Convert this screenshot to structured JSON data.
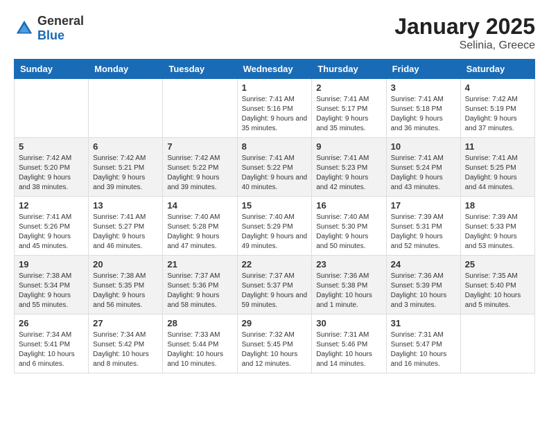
{
  "logo": {
    "general": "General",
    "blue": "Blue"
  },
  "title": "January 2025",
  "subtitle": "Selinia, Greece",
  "weekdays": [
    "Sunday",
    "Monday",
    "Tuesday",
    "Wednesday",
    "Thursday",
    "Friday",
    "Saturday"
  ],
  "weeks": [
    [
      {
        "day": "",
        "info": ""
      },
      {
        "day": "",
        "info": ""
      },
      {
        "day": "",
        "info": ""
      },
      {
        "day": "1",
        "info": "Sunrise: 7:41 AM\nSunset: 5:16 PM\nDaylight: 9 hours and 35 minutes."
      },
      {
        "day": "2",
        "info": "Sunrise: 7:41 AM\nSunset: 5:17 PM\nDaylight: 9 hours and 35 minutes."
      },
      {
        "day": "3",
        "info": "Sunrise: 7:41 AM\nSunset: 5:18 PM\nDaylight: 9 hours and 36 minutes."
      },
      {
        "day": "4",
        "info": "Sunrise: 7:42 AM\nSunset: 5:19 PM\nDaylight: 9 hours and 37 minutes."
      }
    ],
    [
      {
        "day": "5",
        "info": "Sunrise: 7:42 AM\nSunset: 5:20 PM\nDaylight: 9 hours and 38 minutes."
      },
      {
        "day": "6",
        "info": "Sunrise: 7:42 AM\nSunset: 5:21 PM\nDaylight: 9 hours and 39 minutes."
      },
      {
        "day": "7",
        "info": "Sunrise: 7:42 AM\nSunset: 5:22 PM\nDaylight: 9 hours and 39 minutes."
      },
      {
        "day": "8",
        "info": "Sunrise: 7:41 AM\nSunset: 5:22 PM\nDaylight: 9 hours and 40 minutes."
      },
      {
        "day": "9",
        "info": "Sunrise: 7:41 AM\nSunset: 5:23 PM\nDaylight: 9 hours and 42 minutes."
      },
      {
        "day": "10",
        "info": "Sunrise: 7:41 AM\nSunset: 5:24 PM\nDaylight: 9 hours and 43 minutes."
      },
      {
        "day": "11",
        "info": "Sunrise: 7:41 AM\nSunset: 5:25 PM\nDaylight: 9 hours and 44 minutes."
      }
    ],
    [
      {
        "day": "12",
        "info": "Sunrise: 7:41 AM\nSunset: 5:26 PM\nDaylight: 9 hours and 45 minutes."
      },
      {
        "day": "13",
        "info": "Sunrise: 7:41 AM\nSunset: 5:27 PM\nDaylight: 9 hours and 46 minutes."
      },
      {
        "day": "14",
        "info": "Sunrise: 7:40 AM\nSunset: 5:28 PM\nDaylight: 9 hours and 47 minutes."
      },
      {
        "day": "15",
        "info": "Sunrise: 7:40 AM\nSunset: 5:29 PM\nDaylight: 9 hours and 49 minutes."
      },
      {
        "day": "16",
        "info": "Sunrise: 7:40 AM\nSunset: 5:30 PM\nDaylight: 9 hours and 50 minutes."
      },
      {
        "day": "17",
        "info": "Sunrise: 7:39 AM\nSunset: 5:31 PM\nDaylight: 9 hours and 52 minutes."
      },
      {
        "day": "18",
        "info": "Sunrise: 7:39 AM\nSunset: 5:33 PM\nDaylight: 9 hours and 53 minutes."
      }
    ],
    [
      {
        "day": "19",
        "info": "Sunrise: 7:38 AM\nSunset: 5:34 PM\nDaylight: 9 hours and 55 minutes."
      },
      {
        "day": "20",
        "info": "Sunrise: 7:38 AM\nSunset: 5:35 PM\nDaylight: 9 hours and 56 minutes."
      },
      {
        "day": "21",
        "info": "Sunrise: 7:37 AM\nSunset: 5:36 PM\nDaylight: 9 hours and 58 minutes."
      },
      {
        "day": "22",
        "info": "Sunrise: 7:37 AM\nSunset: 5:37 PM\nDaylight: 9 hours and 59 minutes."
      },
      {
        "day": "23",
        "info": "Sunrise: 7:36 AM\nSunset: 5:38 PM\nDaylight: 10 hours and 1 minute."
      },
      {
        "day": "24",
        "info": "Sunrise: 7:36 AM\nSunset: 5:39 PM\nDaylight: 10 hours and 3 minutes."
      },
      {
        "day": "25",
        "info": "Sunrise: 7:35 AM\nSunset: 5:40 PM\nDaylight: 10 hours and 5 minutes."
      }
    ],
    [
      {
        "day": "26",
        "info": "Sunrise: 7:34 AM\nSunset: 5:41 PM\nDaylight: 10 hours and 6 minutes."
      },
      {
        "day": "27",
        "info": "Sunrise: 7:34 AM\nSunset: 5:42 PM\nDaylight: 10 hours and 8 minutes."
      },
      {
        "day": "28",
        "info": "Sunrise: 7:33 AM\nSunset: 5:44 PM\nDaylight: 10 hours and 10 minutes."
      },
      {
        "day": "29",
        "info": "Sunrise: 7:32 AM\nSunset: 5:45 PM\nDaylight: 10 hours and 12 minutes."
      },
      {
        "day": "30",
        "info": "Sunrise: 7:31 AM\nSunset: 5:46 PM\nDaylight: 10 hours and 14 minutes."
      },
      {
        "day": "31",
        "info": "Sunrise: 7:31 AM\nSunset: 5:47 PM\nDaylight: 10 hours and 16 minutes."
      },
      {
        "day": "",
        "info": ""
      }
    ]
  ]
}
